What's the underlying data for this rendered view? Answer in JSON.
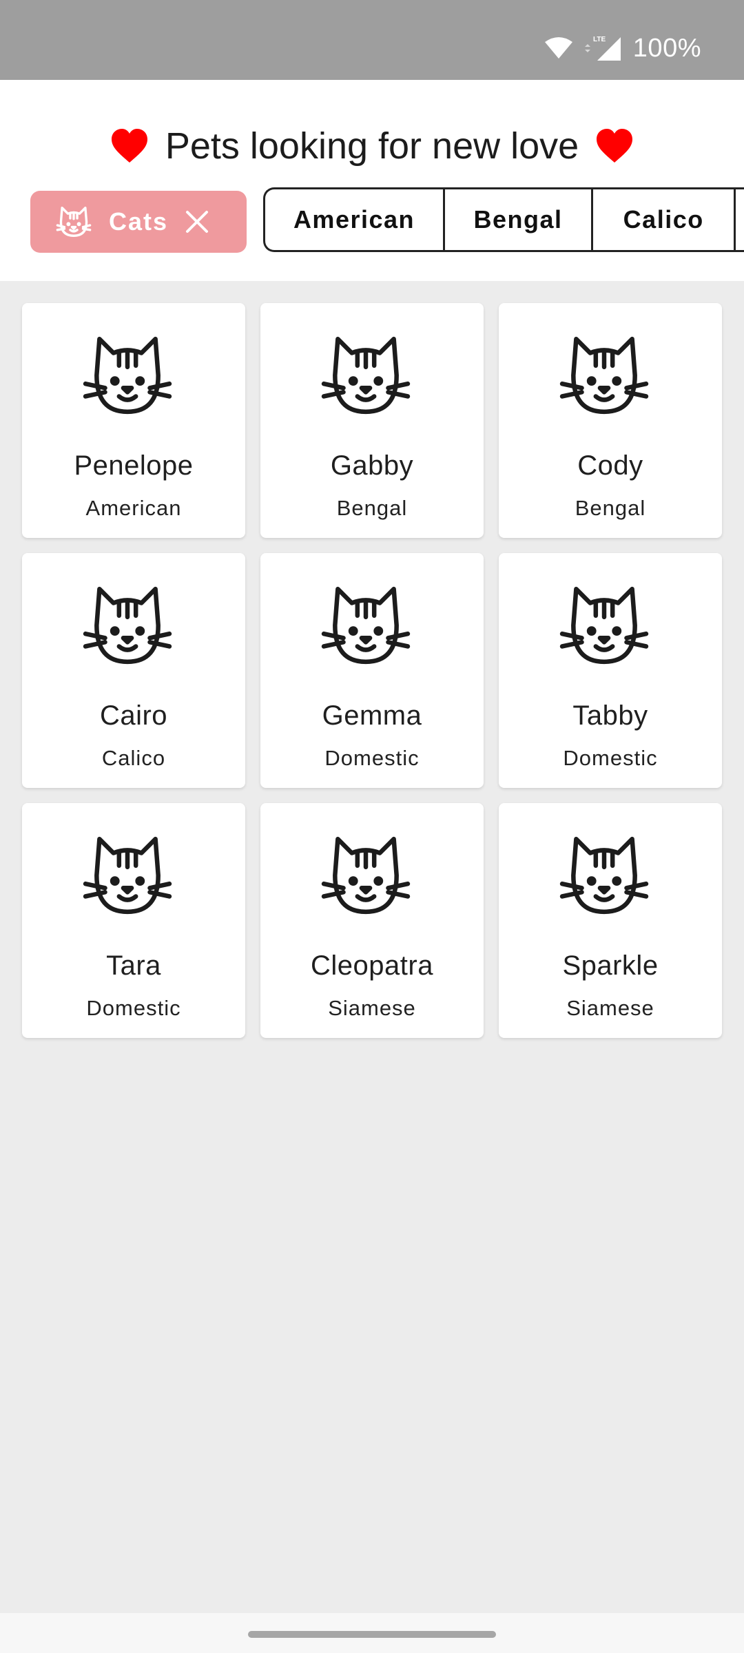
{
  "status_bar": {
    "battery": "100%",
    "network": "LTE",
    "icons": [
      "wifi-icon",
      "signal-icon"
    ]
  },
  "header": {
    "title": "Pets looking for new love",
    "heart_color": "#ff0000"
  },
  "filter": {
    "chip_label": "Cats",
    "chip_color": "#ef9a9e",
    "icon": "cat-icon",
    "clear_icon": "close-icon"
  },
  "breed_tabs": [
    "American",
    "Bengal",
    "Calico"
  ],
  "pets": [
    {
      "name": "Penelope",
      "breed": "American"
    },
    {
      "name": "Gabby",
      "breed": "Bengal"
    },
    {
      "name": "Cody",
      "breed": "Bengal"
    },
    {
      "name": "Cairo",
      "breed": "Calico"
    },
    {
      "name": "Gemma",
      "breed": "Domestic"
    },
    {
      "name": "Tabby",
      "breed": "Domestic"
    },
    {
      "name": "Tara",
      "breed": "Domestic"
    },
    {
      "name": "Cleopatra",
      "breed": "Siamese"
    },
    {
      "name": "Sparkle",
      "breed": "Siamese"
    }
  ]
}
